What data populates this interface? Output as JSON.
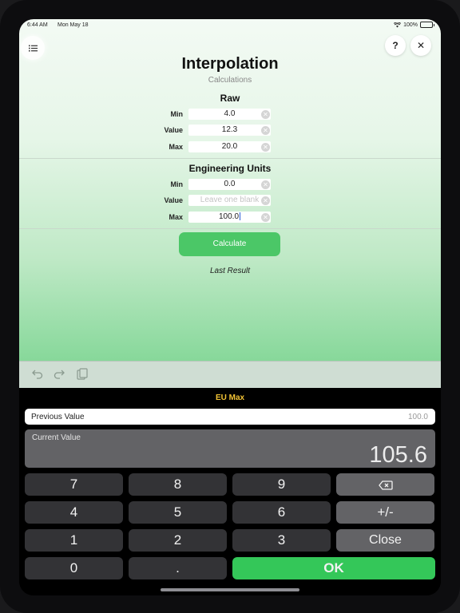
{
  "status": {
    "time": "6:44 AM",
    "date": "Mon May 18",
    "battery": "100%",
    "battery_level": 1.0
  },
  "header": {
    "title": "Interpolation",
    "subtitle": "Calculations",
    "help_label": "?",
    "close_label": "✕"
  },
  "raw": {
    "title": "Raw",
    "rows": [
      {
        "label": "Min",
        "value": "4.0"
      },
      {
        "label": "Value",
        "value": "12.3"
      },
      {
        "label": "Max",
        "value": "20.0"
      }
    ]
  },
  "eu": {
    "title": "Engineering Units",
    "rows": [
      {
        "label": "Min",
        "value": "0.0"
      },
      {
        "label": "Value",
        "value": "",
        "placeholder": "Leave one blank"
      },
      {
        "label": "Max",
        "value": "100.0"
      }
    ]
  },
  "actions": {
    "calculate_label": "Calculate",
    "last_result_label": "Last Result"
  },
  "keypad": {
    "title": "EU Max",
    "previous_label": "Previous Value",
    "previous_value": "100.0",
    "current_label": "Current Value",
    "current_value": "105.6",
    "keys": {
      "k7": "7",
      "k8": "8",
      "k9": "9",
      "k4": "4",
      "k5": "5",
      "k6": "6",
      "k1": "1",
      "k2": "2",
      "k3": "3",
      "k0": "0",
      "dot": ".",
      "plusminus": "+/-",
      "close": "Close",
      "ok": "OK"
    }
  },
  "colors": {
    "accent_green": "#34c759",
    "title_yellow": "#f2c335",
    "calc_green": "#4bc767"
  },
  "icons": [
    "list-icon",
    "help-icon",
    "close-icon",
    "undo-icon",
    "redo-icon",
    "clipboard-icon",
    "backspace-icon",
    "clear-field-icon"
  ]
}
